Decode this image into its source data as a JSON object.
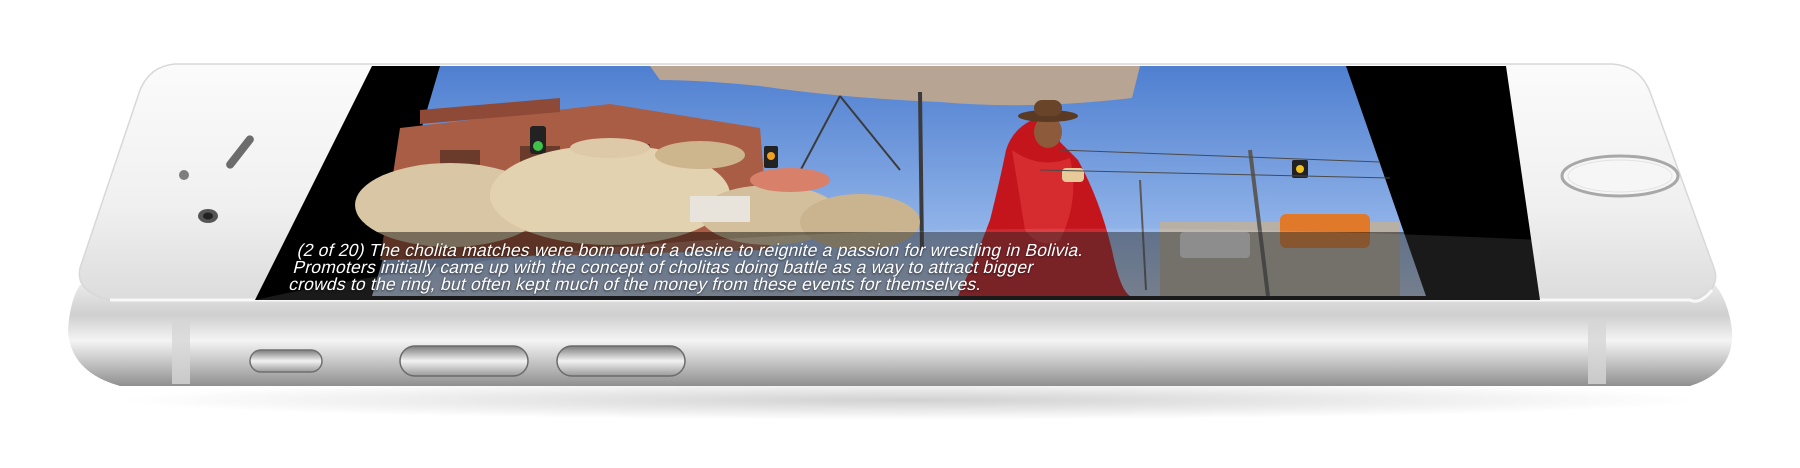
{
  "photo": {
    "caption_lines": [
      "(2 of 20) The cholita matches were born out of a desire to reignite a passion for wrestling in Bolivia.",
      "Promoters initially came up with the concept of cholitas doing battle as a way to attract bigger",
      "crowds to the ring, but often kept much of the money from these events for themselves."
    ],
    "subject": "woman in red dress and bowler hat at market stall"
  },
  "device": {
    "body_color": "#f2f2f2",
    "screen_color": "#000000",
    "buttons": [
      "mute-switch",
      "volume-up",
      "volume-down"
    ],
    "home_button": "home-button"
  },
  "colors": {
    "sky": "#6f9be0",
    "dress": "#c4141c",
    "building": "#a85d44",
    "awning": "#b8a493",
    "sacks": "#d9c6a4"
  }
}
